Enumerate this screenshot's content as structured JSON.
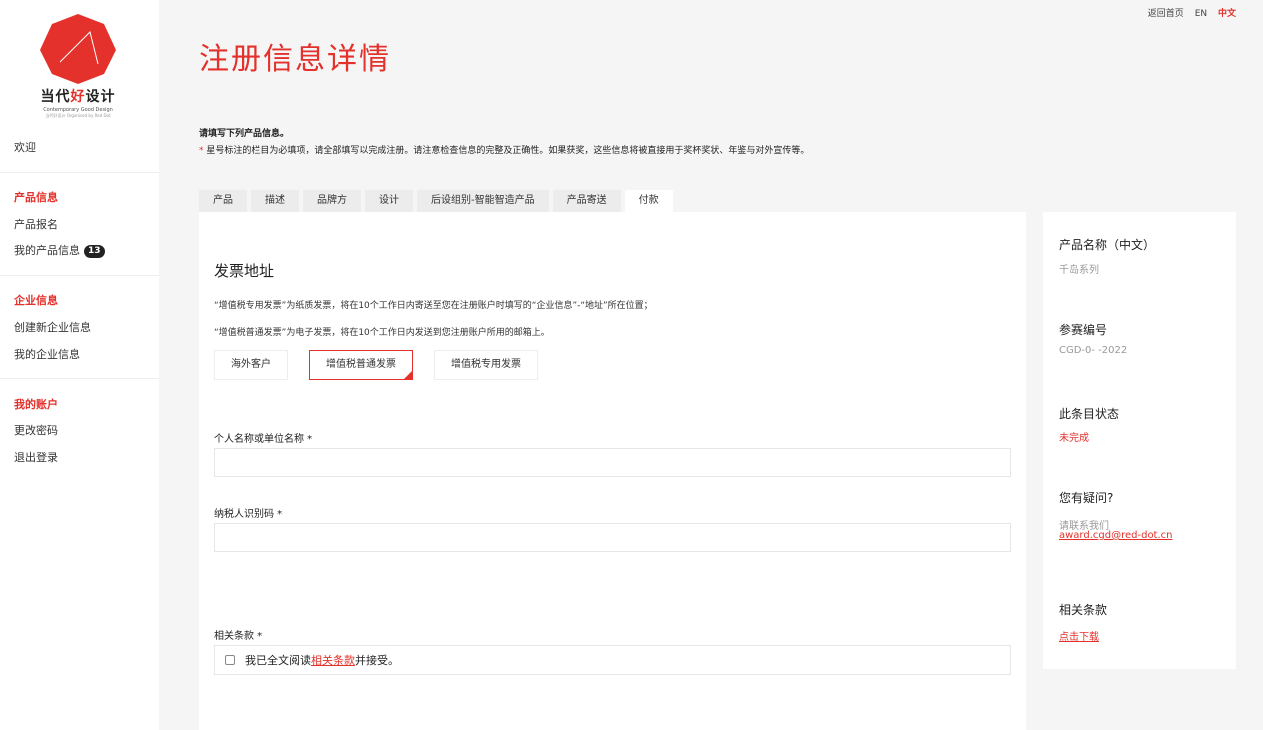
{
  "brand": {
    "name_prefix": "当代",
    "name_accent": "好",
    "name_suffix": "设计",
    "subtitle": "Contemporary Good Design",
    "tagline": "当代好设计 Organised by Red Dot",
    "accent_color": "#e4312b"
  },
  "topbar": {
    "home": "返回首页",
    "lang_en": "EN",
    "lang_zh": "中文"
  },
  "sidebar": {
    "welcome": "欢迎",
    "product_section": "产品信息",
    "product_register": "产品报名",
    "my_products": "我的产品信息",
    "my_products_count": "13",
    "company_section": "企业信息",
    "create_company": "创建新企业信息",
    "my_company": "我的企业信息",
    "account_section": "我的账户",
    "change_password": "更改密码",
    "logout": "退出登录"
  },
  "page": {
    "title": "注册信息详情",
    "intro_line1": "请填写下列产品信息。",
    "intro_star": "*",
    "intro_line2": "星号标注的栏目为必填项，请全部填写以完成注册。请注意检查信息的完整及正确性。如果获奖，这些信息将被直接用于奖杯奖状、年鉴与对外宣传等。"
  },
  "tabs": [
    "产品",
    "描述",
    "品牌方",
    "设计",
    "后设组别-智能智造产品",
    "产品寄送",
    "付款"
  ],
  "active_tab": "付款",
  "invoice": {
    "section_title": "发票地址",
    "note1": "“增值税专用发票”为纸质发票，将在10个工作日内寄送至您在注册账户时填写的“企业信息”-“地址”所在位置；",
    "note2": "“增值税普通发票”为电子发票，将在10个工作日内发送到您注册账户所用的邮箱上。",
    "options": [
      "海外客户",
      "增值税普通发票",
      "增值税专用发票"
    ],
    "selected_option": "增值税普通发票",
    "name_label": "个人名称或单位名称 *",
    "name_value": "",
    "tax_label": "纳税人识别码 *",
    "tax_value": "",
    "terms_label": "相关条款 *",
    "terms_prefix": "我已全文阅读",
    "terms_link": "相关条款",
    "terms_suffix": "并接受。"
  },
  "right_panel": {
    "product_name_title": "产品名称（中文）",
    "product_name_value": "千岛系列",
    "ref_title": "参赛编号",
    "ref_value": "CGD-0-      -2022",
    "status_title": "此条目状态",
    "status_value": "未完成",
    "question_title": "您有疑问?",
    "contact_text": "请联系我们",
    "contact_email": "award.cgd@red-dot.cn",
    "terms_title": "相关条款",
    "download": "点击下载"
  }
}
